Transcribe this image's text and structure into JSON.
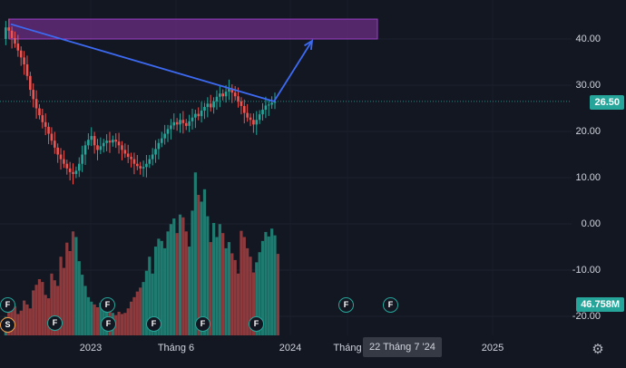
{
  "colors": {
    "background": "#131722",
    "up": "#26a69a",
    "down": "#ef5350",
    "volume_up": "#1f7a6f",
    "volume_down": "#8e3a3d",
    "trendline": "#3d6af2",
    "zone_fill": "#6a2d82",
    "zone_border": "#9b3fc4"
  },
  "price_axis": {
    "ticks": [
      "40.00",
      "30.00",
      "20.00",
      "10.00",
      "0.00",
      "-10.00",
      "-20.00"
    ],
    "tick_values": [
      40,
      30,
      20,
      10,
      0,
      -10,
      -20
    ],
    "current_price": {
      "label": "26.50",
      "value": 26.5,
      "color": "#26a69a"
    },
    "volume_tag": {
      "label": "46.758M",
      "color": "#26a69a"
    }
  },
  "time_axis": {
    "labels": [
      "2023",
      "Tháng 6",
      "2024",
      "Tháng",
      "2025"
    ],
    "crosshair_label": "22 Tháng 7 '24"
  },
  "events": [
    {
      "type": "dividend",
      "label": "F"
    },
    {
      "type": "dividend",
      "label": "F"
    },
    {
      "type": "dividend",
      "label": "F"
    },
    {
      "type": "dividend",
      "label": "F"
    },
    {
      "type": "split",
      "label": "S"
    },
    {
      "type": "dividend",
      "label": "F"
    },
    {
      "type": "dividend",
      "label": "F"
    },
    {
      "type": "dividend",
      "label": "F"
    },
    {
      "type": "dividend",
      "label": "F"
    },
    {
      "type": "dividend",
      "label": "F"
    }
  ],
  "icons": {
    "settings": "gear-icon"
  },
  "chart_data": {
    "type": "candlestick",
    "price_path": [
      40,
      42.5,
      41.8,
      40.2,
      39,
      37.5,
      36,
      34.5,
      32,
      29,
      27,
      25,
      23.5,
      22,
      21,
      19.5,
      18,
      16.5,
      15,
      14,
      13,
      12,
      11.2,
      10.8,
      11.5,
      13,
      15,
      17,
      18.2,
      19,
      17,
      16,
      16.8,
      17.5,
      18,
      17.6,
      18.2,
      17.8,
      17,
      16,
      15.2,
      14.5,
      14,
      13,
      12.5,
      12,
      12.3,
      13,
      14,
      15,
      16.2,
      17.5,
      18.5,
      19.5,
      20.5,
      21.3,
      22,
      21.5,
      22.5,
      21.8,
      21.2,
      22.2,
      23,
      23.8,
      23.3,
      24.5,
      25.3,
      26,
      25.2,
      26.5,
      27.5,
      28.2,
      27.6,
      28.6,
      29.3,
      28.4,
      27.6,
      26.5,
      25.5,
      24,
      23,
      22.5,
      21.5,
      22.5,
      23.7,
      24.7,
      25.6,
      25.8,
      26.2,
      26.5
    ],
    "volume": [
      33,
      42,
      58,
      52,
      38,
      44,
      62,
      55,
      48,
      80,
      90,
      100,
      95,
      72,
      66,
      110,
      98,
      88,
      140,
      120,
      165,
      150,
      185,
      175,
      132,
      108,
      88,
      68,
      60,
      55,
      50,
      58,
      52,
      46,
      43,
      40,
      36,
      42,
      38,
      40,
      48,
      60,
      68,
      78,
      85,
      95,
      115,
      140,
      110,
      158,
      172,
      168,
      155,
      185,
      198,
      208,
      182,
      215,
      210,
      185,
      158,
      222,
      290,
      250,
      238,
      260,
      212,
      166,
      200,
      175,
      198,
      182,
      155,
      166,
      146,
      134,
      110,
      186,
      175,
      155,
      140,
      112,
      130,
      148,
      168,
      184,
      176,
      190,
      178,
      145
    ],
    "drawings": {
      "trendline": {
        "from": [
          "2022-12",
          43.2
        ],
        "to": [
          "2023-11",
          26.5
        ]
      },
      "projection_arrow": {
        "from": [
          "2023-11",
          26.5
        ],
        "to": [
          "2023-12",
          40
        ]
      },
      "target_zone": {
        "price_low": 40,
        "price_high": 44.3
      }
    }
  }
}
